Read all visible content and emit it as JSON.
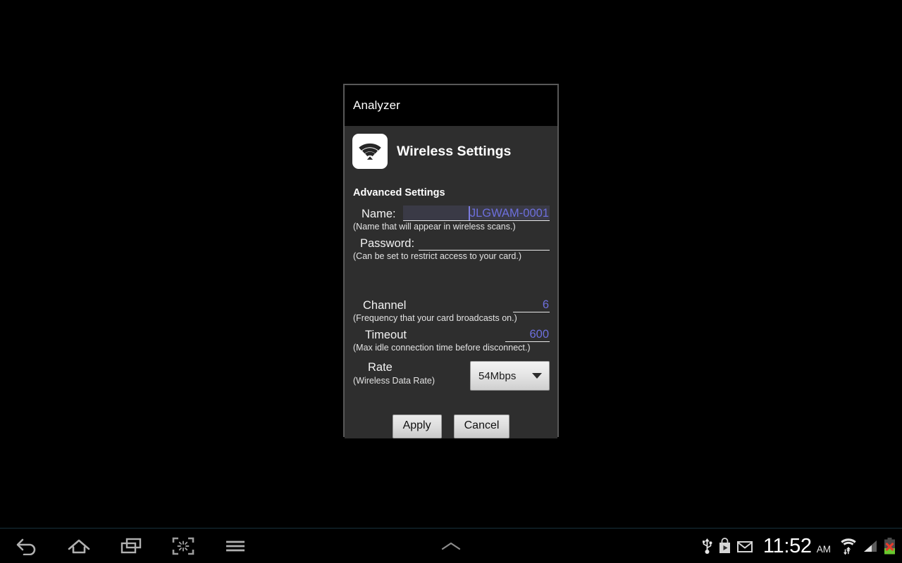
{
  "dialog": {
    "window_title": "Analyzer",
    "header": {
      "icon": "wifi-icon",
      "title": "Wireless Settings"
    },
    "section_title": "Advanced Settings",
    "fields": [
      {
        "label": "Name:",
        "value": "JLGWAM-0001",
        "hint": "(Name that will appear in wireless scans.)"
      },
      {
        "label": "Password:",
        "value": "",
        "hint": "(Can be set to restrict access to your card.)"
      },
      {
        "label": "Channel",
        "value": "6",
        "hint": "(Frequency that your card broadcasts on.)"
      },
      {
        "label": "Timeout",
        "value": "600",
        "hint": "(Max idle connection time before disconnect.)"
      },
      {
        "label": "Rate",
        "value": "54Mbps",
        "hint": "(Wireless Data Rate)"
      }
    ],
    "buttons": {
      "apply": "Apply",
      "cancel": "Cancel"
    },
    "colors": {
      "value_text": "#6d6fdc",
      "dialog_bg": "#2e2e2e",
      "titlebar_bg": "#000000",
      "border": "#585858"
    }
  },
  "navbar": {
    "buttons": [
      {
        "name": "back-icon",
        "label": "Back"
      },
      {
        "name": "home-icon",
        "label": "Home"
      },
      {
        "name": "recents-icon",
        "label": "Recent apps"
      },
      {
        "name": "screenshot-icon",
        "label": "Screenshot"
      },
      {
        "name": "menu-icon",
        "label": "Menu"
      }
    ],
    "center": {
      "name": "chevron-up-icon",
      "label": "Show notifications"
    }
  },
  "statusbar": {
    "icons": [
      {
        "name": "usb-icon",
        "label": "USB connected"
      },
      {
        "name": "play-store-icon",
        "label": "Play Store"
      },
      {
        "name": "gmail-icon",
        "label": "Gmail"
      }
    ],
    "time": "11:52",
    "meridiem": "AM",
    "right_icons": [
      {
        "name": "wifi-icon",
        "label": "Wi-Fi"
      },
      {
        "name": "cell-signal-icon",
        "label": "Cellular signal"
      },
      {
        "name": "battery-error-icon",
        "label": "Battery"
      }
    ]
  }
}
